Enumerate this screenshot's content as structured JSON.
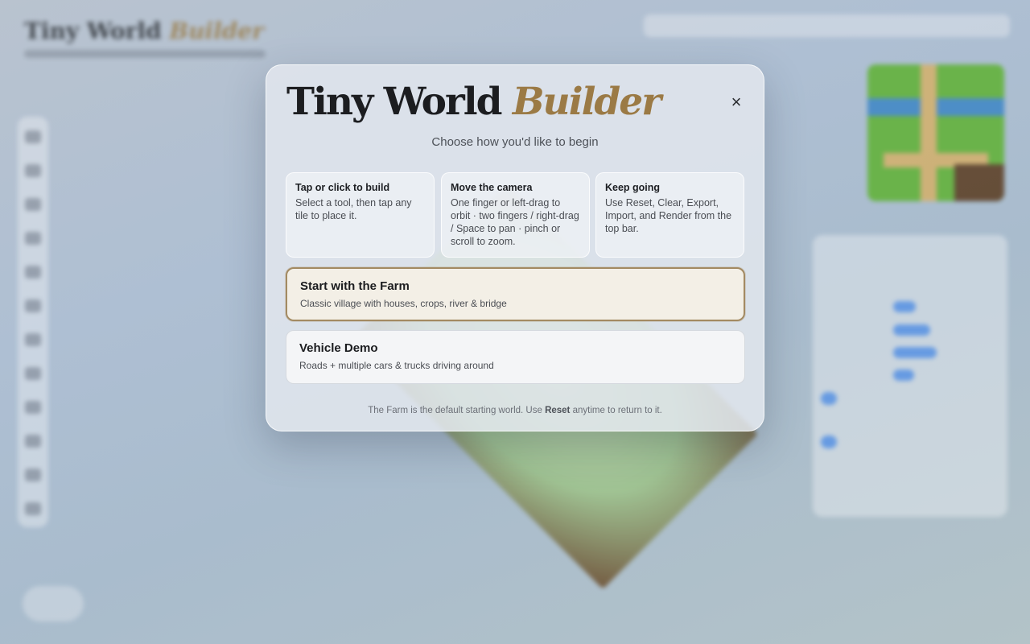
{
  "modal": {
    "title_main": "Tiny World",
    "title_accent": "Builder",
    "close_label": "×",
    "subtitle": "Choose how you'd like to begin",
    "tips": [
      {
        "title": "Tap or click to build",
        "body": "Select a tool, then tap any tile to place it."
      },
      {
        "title": "Move the camera",
        "body": "One finger or left-drag to orbit · two fingers / right-drag / Space to pan · pinch or scroll to zoom."
      },
      {
        "title": "Keep going",
        "body": "Use Reset, Clear, Export, Import, and Render from the top bar."
      }
    ],
    "options": [
      {
        "title": "Start with the Farm",
        "desc": "Classic village with houses, crops, river & bridge"
      },
      {
        "title": "Vehicle Demo",
        "desc": "Roads + multiple cars & trucks driving around"
      }
    ],
    "footer": {
      "pre": "The Farm is the default starting world. Use ",
      "strong": "Reset",
      "post": " anytime to return to it."
    }
  },
  "background": {
    "app_title_main": "Tiny World",
    "app_title_accent": "Builder"
  },
  "colors": {
    "accent": "#9b7a45",
    "primary_border": "#a38a62",
    "toggle_blue": "#5b95e6"
  }
}
